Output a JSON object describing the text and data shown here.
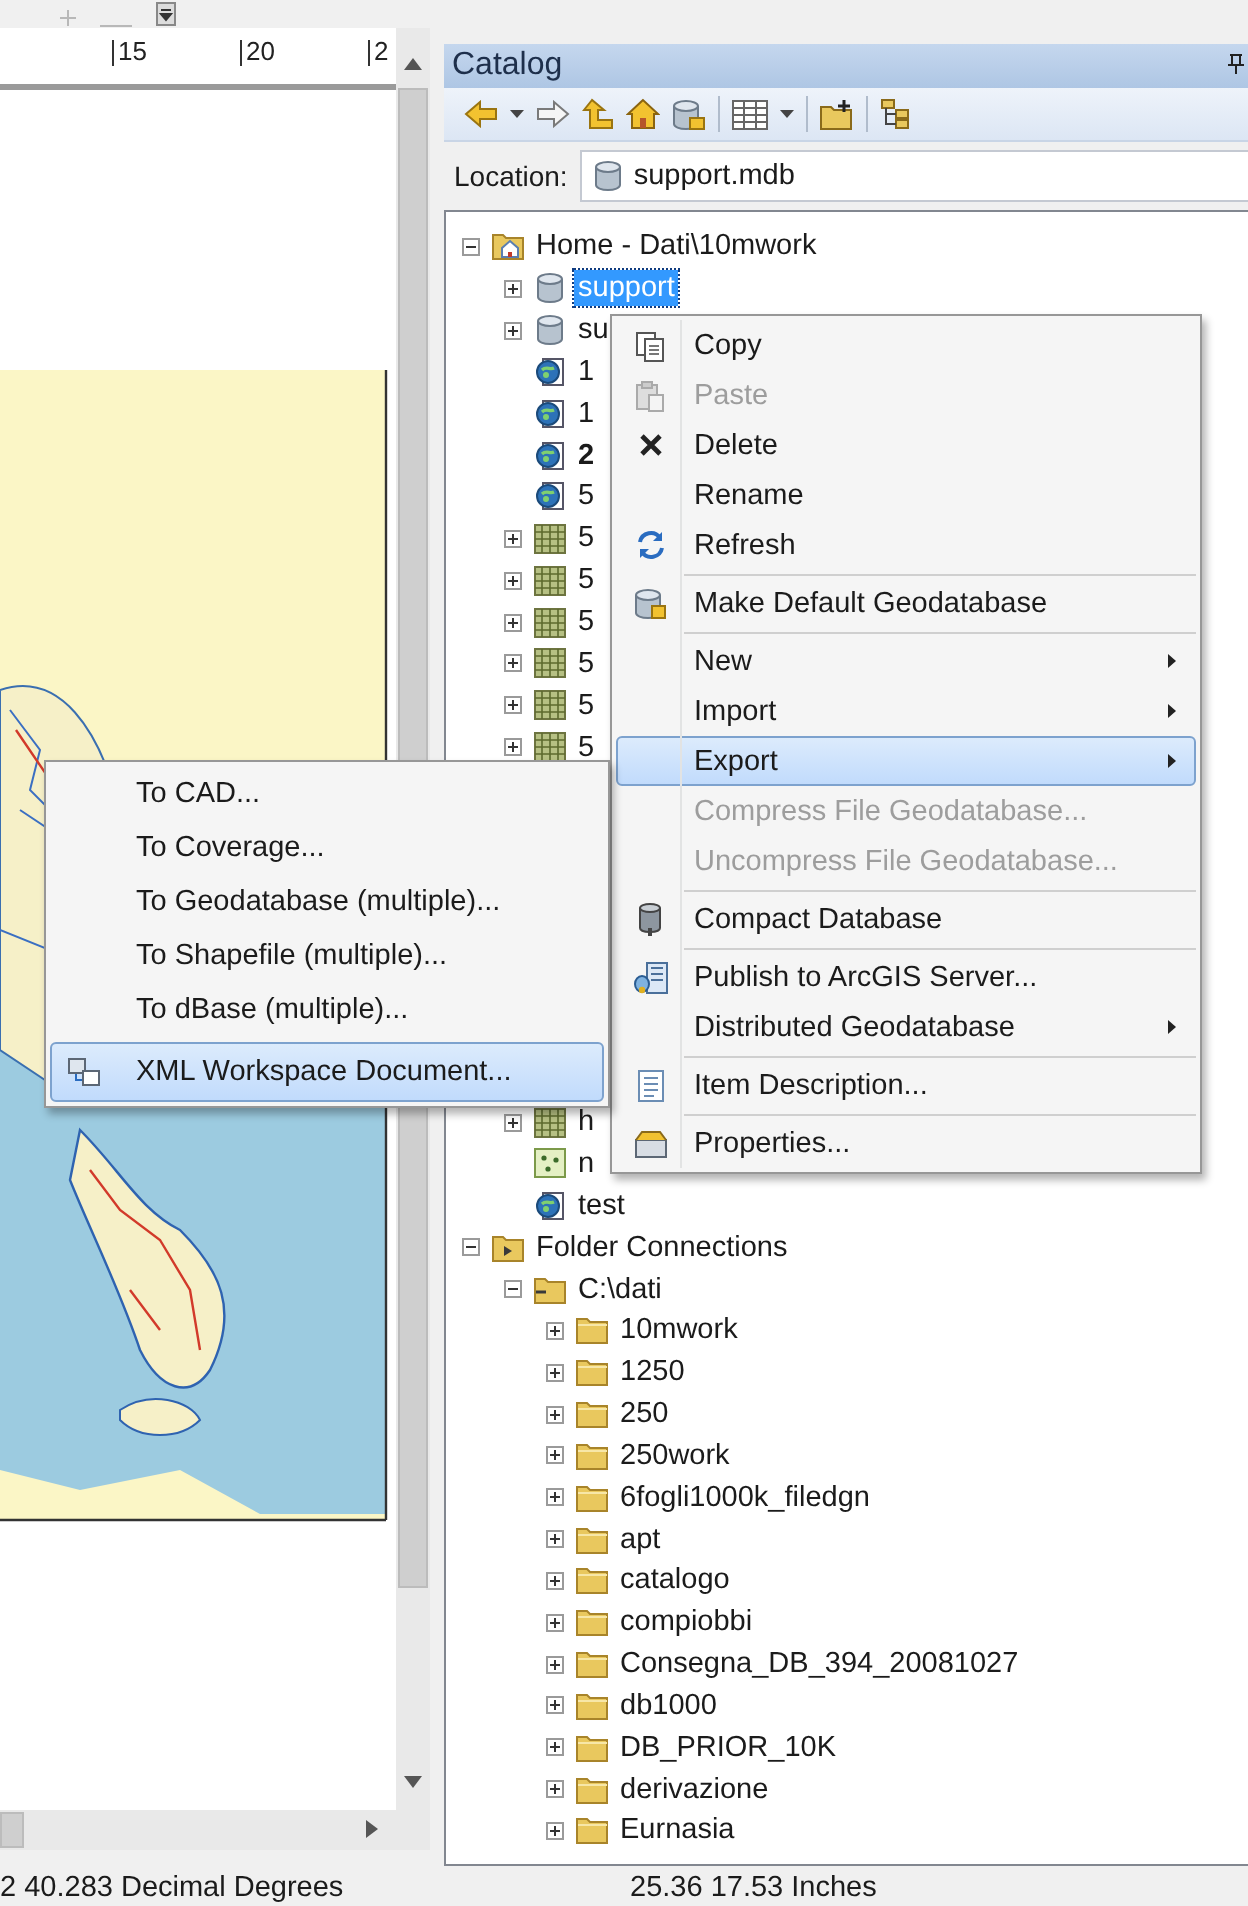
{
  "map_view": {
    "ruler_labels": [
      "15",
      "20",
      "2"
    ]
  },
  "catalog": {
    "title": "Catalog",
    "location_label": "Location:",
    "location": "support.mdb",
    "tree": [
      {
        "kind": "home_folder",
        "label": "Home - Dati\\10mwork",
        "expanded": true,
        "selected": false,
        "children": [
          {
            "kind": "database",
            "label": "support",
            "expanded": false,
            "selected": true
          },
          {
            "kind": "database",
            "label": "su",
            "expanded": false,
            "selected": false
          },
          {
            "kind": "query",
            "label": "1",
            "selected": false
          },
          {
            "kind": "query",
            "label": "1",
            "selected": false
          },
          {
            "kind": "query",
            "label": "2",
            "bold": true,
            "selected": false
          },
          {
            "kind": "query",
            "label": "5",
            "selected": false
          },
          {
            "kind": "raster",
            "label": "5",
            "expanded": false,
            "selected": false
          },
          {
            "kind": "raster",
            "label": "5",
            "expanded": false,
            "selected": false
          },
          {
            "kind": "raster",
            "label": "5",
            "expanded": false,
            "selected": false
          },
          {
            "kind": "raster",
            "label": "5",
            "expanded": false,
            "selected": false
          },
          {
            "kind": "raster",
            "label": "5",
            "expanded": false,
            "selected": false
          },
          {
            "kind": "raster",
            "label": "5",
            "expanded": false,
            "selected": false
          },
          {
            "kind": "covered"
          },
          {
            "kind": "covered"
          },
          {
            "kind": "covered"
          },
          {
            "kind": "covered"
          },
          {
            "kind": "covered"
          },
          {
            "kind": "covered"
          },
          {
            "kind": "covered"
          },
          {
            "kind": "covered"
          },
          {
            "kind": "raster",
            "label": "h",
            "expanded": false,
            "selected": false
          },
          {
            "kind": "point",
            "label": "n",
            "selected": false
          },
          {
            "kind": "query",
            "label": "test",
            "selected": false
          }
        ]
      },
      {
        "kind": "folder_connections",
        "label": "Folder Connections",
        "expanded": true,
        "selected": false,
        "children": [
          {
            "kind": "folder_link",
            "label": "C:\\dati",
            "expanded": true,
            "selected": false,
            "children": [
              {
                "kind": "folder",
                "label": "10mwork",
                "expanded": false,
                "selected": false
              },
              {
                "kind": "folder",
                "label": "1250",
                "expanded": false,
                "selected": false
              },
              {
                "kind": "folder",
                "label": "250",
                "expanded": false,
                "selected": false
              },
              {
                "kind": "folder",
                "label": "250work",
                "expanded": false,
                "selected": false
              },
              {
                "kind": "folder",
                "label": "6fogli1000k_filedgn",
                "expanded": false,
                "selected": false
              },
              {
                "kind": "folder",
                "label": "apt",
                "expanded": false,
                "selected": false
              },
              {
                "kind": "folder",
                "label": "catalogo",
                "expanded": false,
                "selected": false
              },
              {
                "kind": "folder",
                "label": "compiobbi",
                "expanded": false,
                "selected": false
              },
              {
                "kind": "folder",
                "label": "Consegna_DB_394_20081027",
                "expanded": false,
                "selected": false
              },
              {
                "kind": "folder",
                "label": "db1000",
                "expanded": false,
                "selected": false
              },
              {
                "kind": "folder",
                "label": "DB_PRIOR_10K",
                "expanded": false,
                "selected": false
              },
              {
                "kind": "folder",
                "label": "derivazione",
                "expanded": false,
                "selected": false
              },
              {
                "kind": "folder",
                "label": "Eurnasia",
                "expanded": false,
                "selected": false
              }
            ]
          }
        ]
      }
    ]
  },
  "context_menu": {
    "items": [
      {
        "label": "Copy",
        "disabled": false,
        "selected": false,
        "has_submenu": false,
        "separator_before": false
      },
      {
        "label": "Paste",
        "disabled": true,
        "selected": false,
        "has_submenu": false,
        "separator_before": false
      },
      {
        "label": "Delete",
        "disabled": false,
        "selected": false,
        "has_submenu": false,
        "separator_before": false
      },
      {
        "label": "Rename",
        "disabled": false,
        "selected": false,
        "has_submenu": false,
        "separator_before": false
      },
      {
        "label": "Refresh",
        "disabled": false,
        "selected": false,
        "has_submenu": false,
        "separator_before": false
      },
      {
        "label": "Make Default Geodatabase",
        "disabled": false,
        "selected": false,
        "has_submenu": false,
        "separator_before": true
      },
      {
        "label": "New",
        "disabled": false,
        "selected": false,
        "has_submenu": true,
        "separator_before": true
      },
      {
        "label": "Import",
        "disabled": false,
        "selected": false,
        "has_submenu": true,
        "separator_before": false
      },
      {
        "label": "Export",
        "disabled": false,
        "selected": true,
        "has_submenu": true,
        "separator_before": false
      },
      {
        "label": "Compress File Geodatabase...",
        "disabled": true,
        "selected": false,
        "has_submenu": false,
        "separator_before": false
      },
      {
        "label": "Uncompress File Geodatabase...",
        "disabled": true,
        "selected": false,
        "has_submenu": false,
        "separator_before": false
      },
      {
        "label": "Compact Database",
        "disabled": false,
        "selected": false,
        "has_submenu": false,
        "separator_before": true
      },
      {
        "label": "Publish to ArcGIS Server...",
        "disabled": false,
        "selected": false,
        "has_submenu": false,
        "separator_before": true
      },
      {
        "label": "Distributed Geodatabase",
        "disabled": false,
        "selected": false,
        "has_submenu": true,
        "separator_before": false
      },
      {
        "label": "Item Description...",
        "disabled": false,
        "selected": false,
        "has_submenu": false,
        "separator_before": true
      },
      {
        "label": "Properties...",
        "disabled": false,
        "selected": false,
        "has_submenu": false,
        "separator_before": true
      }
    ]
  },
  "export_submenu": {
    "items": [
      {
        "label": "To CAD...",
        "selected": false
      },
      {
        "label": "To Coverage...",
        "selected": false
      },
      {
        "label": "To Geodatabase (multiple)...",
        "selected": false
      },
      {
        "label": "To Shapefile (multiple)...",
        "selected": false
      },
      {
        "label": "To dBase (multiple)...",
        "selected": false
      },
      {
        "label": "XML Workspace Document...",
        "selected": true
      }
    ]
  },
  "status_bar": {
    "coordinates": "2 40.283 Decimal Degrees",
    "page_position": "25.36 17.53 Inches"
  }
}
